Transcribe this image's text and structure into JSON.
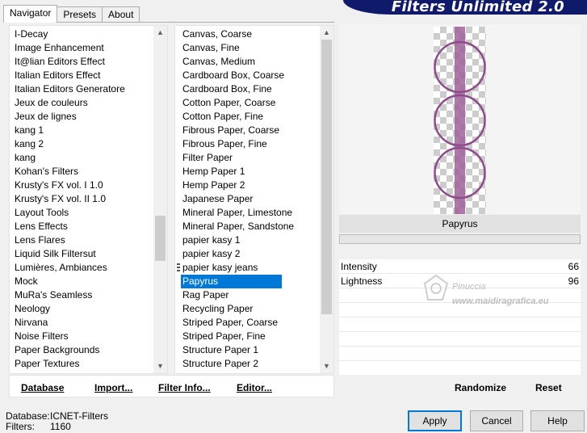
{
  "tabs": [
    "Navigator",
    "Presets",
    "About"
  ],
  "banner": "Filters Unlimited 2.0",
  "categories": [
    "I-Decay",
    "Image Enhancement",
    "It@lian Editors Effect",
    "Italian Editors Effect",
    "Italian Editors Generatore",
    "Jeux de couleurs",
    "Jeux de lignes",
    "kang 1",
    "kang 2",
    "kang",
    "Kohan's Filters",
    "Krusty's FX vol. I 1.0",
    "Krusty's FX vol. II 1.0",
    "Layout Tools",
    "Lens Effects",
    "Lens Flares",
    "Liquid Silk Filtersut",
    "Lumières, Ambiances",
    "Mock",
    "MuRa's Seamless",
    "Neology",
    "Nirvana",
    "Noise Filters",
    "Paper Backgrounds",
    "Paper Textures"
  ],
  "filters": [
    "Canvas, Coarse",
    "Canvas, Fine",
    "Canvas, Medium",
    "Cardboard Box, Coarse",
    "Cardboard Box, Fine",
    "Cotton Paper, Coarse",
    "Cotton Paper, Fine",
    "Fibrous Paper, Coarse",
    "Fibrous Paper, Fine",
    "Filter Paper",
    "Hemp Paper 1",
    "Hemp Paper 2",
    "Japanese Paper",
    "Mineral Paper, Limestone",
    "Mineral Paper, Sandstone",
    "papier kasy 1",
    "papier kasy 2",
    "papier kasy jeans",
    "Papyrus",
    "Rag Paper",
    "Recycling Paper",
    "Striped Paper, Coarse",
    "Striped Paper, Fine",
    "Structure Paper 1",
    "Structure Paper 2"
  ],
  "selected_filter": "Papyrus",
  "left_buttons": {
    "database": "Database",
    "import": "Import...",
    "filter_info": "Filter Info...",
    "editor": "Editor..."
  },
  "preview": {
    "filter_name": "Papyrus"
  },
  "params": [
    {
      "name": "Intensity",
      "value": "66"
    },
    {
      "name": "Lightness",
      "value": "96"
    }
  ],
  "watermark": {
    "line1": "Pinuccia",
    "line2": "www.maidiragrafica.eu"
  },
  "right_buttons": {
    "randomize": "Randomize",
    "reset": "Reset"
  },
  "status": {
    "database_label": "Database:",
    "database_value": "ICNET-Filters",
    "filters_label": "Filters:",
    "filters_value": "1160"
  },
  "dialog_buttons": {
    "apply": "Apply",
    "cancel": "Cancel",
    "help": "Help"
  },
  "colors": {
    "banner": "#101a6b",
    "selection": "#0078d7",
    "ring": "#8e4a8a"
  }
}
